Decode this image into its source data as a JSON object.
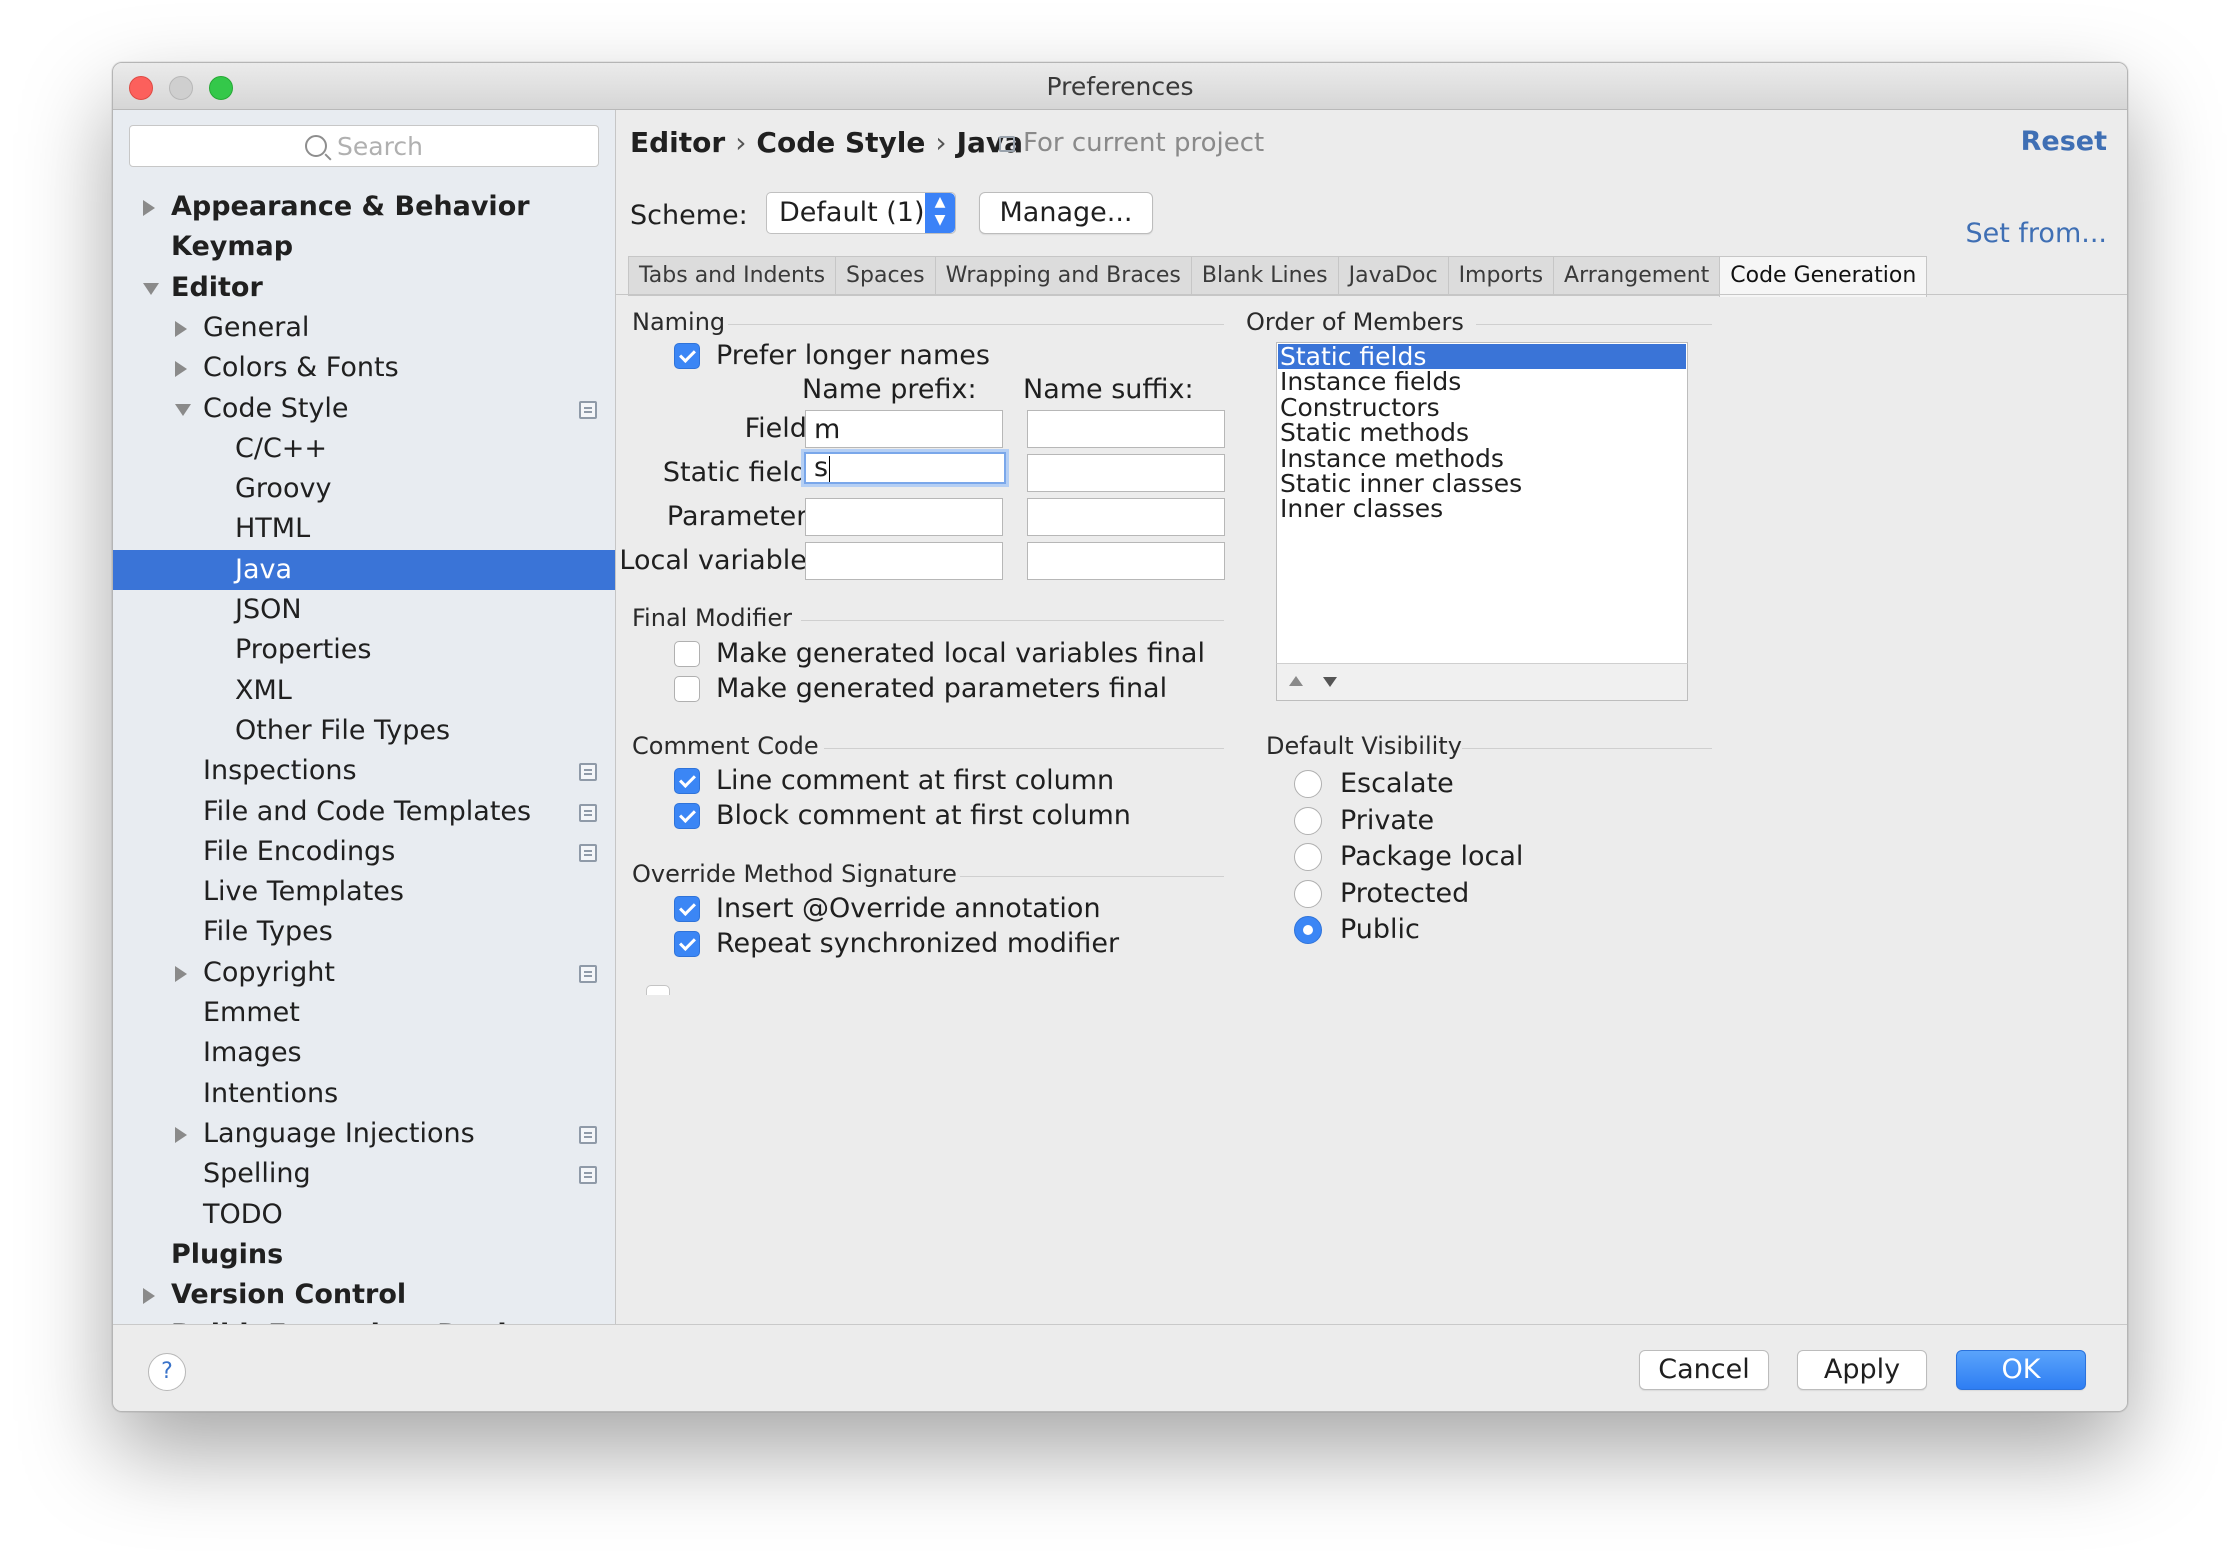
{
  "window": {
    "title": "Preferences"
  },
  "sidebar": {
    "search_placeholder": "Search",
    "items": [
      {
        "label": "Appearance & Behavior",
        "level": 0,
        "arrow": "right",
        "bold": true
      },
      {
        "label": "Keymap",
        "level": 0,
        "bold": true
      },
      {
        "label": "Editor",
        "level": 0,
        "arrow": "down",
        "bold": true
      },
      {
        "label": "General",
        "level": 1,
        "arrow": "right"
      },
      {
        "label": "Colors & Fonts",
        "level": 1,
        "arrow": "right"
      },
      {
        "label": "Code Style",
        "level": 1,
        "arrow": "down",
        "project_icon": true
      },
      {
        "label": "C/C++",
        "level": 2
      },
      {
        "label": "Groovy",
        "level": 2
      },
      {
        "label": "HTML",
        "level": 2
      },
      {
        "label": "Java",
        "level": 2,
        "selected": true
      },
      {
        "label": "JSON",
        "level": 2
      },
      {
        "label": "Properties",
        "level": 2
      },
      {
        "label": "XML",
        "level": 2
      },
      {
        "label": "Other File Types",
        "level": 2
      },
      {
        "label": "Inspections",
        "level": 1,
        "project_icon": true
      },
      {
        "label": "File and Code Templates",
        "level": 1,
        "project_icon": true
      },
      {
        "label": "File Encodings",
        "level": 1,
        "project_icon": true
      },
      {
        "label": "Live Templates",
        "level": 1
      },
      {
        "label": "File Types",
        "level": 1
      },
      {
        "label": "Copyright",
        "level": 1,
        "arrow": "right",
        "project_icon": true
      },
      {
        "label": "Emmet",
        "level": 1
      },
      {
        "label": "Images",
        "level": 1
      },
      {
        "label": "Intentions",
        "level": 1
      },
      {
        "label": "Language Injections",
        "level": 1,
        "arrow": "right",
        "project_icon": true
      },
      {
        "label": "Spelling",
        "level": 1,
        "project_icon": true
      },
      {
        "label": "TODO",
        "level": 1
      },
      {
        "label": "Plugins",
        "level": 0,
        "bold": true
      },
      {
        "label": "Version Control",
        "level": 0,
        "arrow": "right",
        "bold": true
      },
      {
        "label": "Build, Execution, Deployment",
        "level": 0,
        "arrow": "right",
        "bold": true
      }
    ]
  },
  "header": {
    "breadcrumb": [
      "Editor",
      "Code Style",
      "Java"
    ],
    "breadcrumb_sep": "›",
    "for_project": "For current project",
    "reset": "Reset",
    "set_from": "Set from...",
    "scheme_label": "Scheme:",
    "scheme_value": "Default (1)",
    "manage": "Manage..."
  },
  "tabs": [
    {
      "label": "Tabs and Indents"
    },
    {
      "label": "Spaces"
    },
    {
      "label": "Wrapping and Braces"
    },
    {
      "label": "Blank Lines"
    },
    {
      "label": "JavaDoc"
    },
    {
      "label": "Imports"
    },
    {
      "label": "Arrangement"
    },
    {
      "label": "Code Generation",
      "active": true
    }
  ],
  "naming": {
    "title": "Naming",
    "prefer_longer": {
      "label": "Prefer longer names",
      "checked": true
    },
    "prefix_header": "Name prefix:",
    "suffix_header": "Name suffix:",
    "rows": [
      {
        "label": "Field:",
        "prefix": "m",
        "suffix": ""
      },
      {
        "label": "Static field:",
        "prefix": "s",
        "suffix": "",
        "focused": true
      },
      {
        "label": "Parameter:",
        "prefix": "",
        "suffix": ""
      },
      {
        "label": "Local variable:",
        "prefix": "",
        "suffix": ""
      }
    ]
  },
  "final_modifier": {
    "title": "Final Modifier",
    "options": [
      {
        "label": "Make generated local variables final",
        "checked": false
      },
      {
        "label": "Make generated parameters final",
        "checked": false
      }
    ]
  },
  "comment_code": {
    "title": "Comment Code",
    "options": [
      {
        "label": "Line comment at first column",
        "checked": true
      },
      {
        "label": "Block comment at first column",
        "checked": true
      }
    ]
  },
  "override": {
    "title": "Override Method Signature",
    "options": [
      {
        "label": "Insert @Override annotation",
        "checked": true
      },
      {
        "label": "Repeat synchronized modifier",
        "checked": true
      }
    ]
  },
  "order_of_members": {
    "title": "Order of Members",
    "items": [
      "Static fields",
      "Instance fields",
      "Constructors",
      "Static methods",
      "Instance methods",
      "Static inner classes",
      "Inner classes"
    ],
    "selected_index": 0
  },
  "default_visibility": {
    "title": "Default Visibility",
    "options": [
      {
        "label": "Escalate",
        "checked": false
      },
      {
        "label": "Private",
        "checked": false
      },
      {
        "label": "Package local",
        "checked": false
      },
      {
        "label": "Protected",
        "checked": false
      },
      {
        "label": "Public",
        "checked": true
      }
    ]
  },
  "footer": {
    "help": "?",
    "cancel": "Cancel",
    "apply": "Apply",
    "ok": "OK"
  },
  "colors": {
    "selection": "#3a74d7",
    "accent": "#3b86f5",
    "link": "#3f6fb4"
  }
}
